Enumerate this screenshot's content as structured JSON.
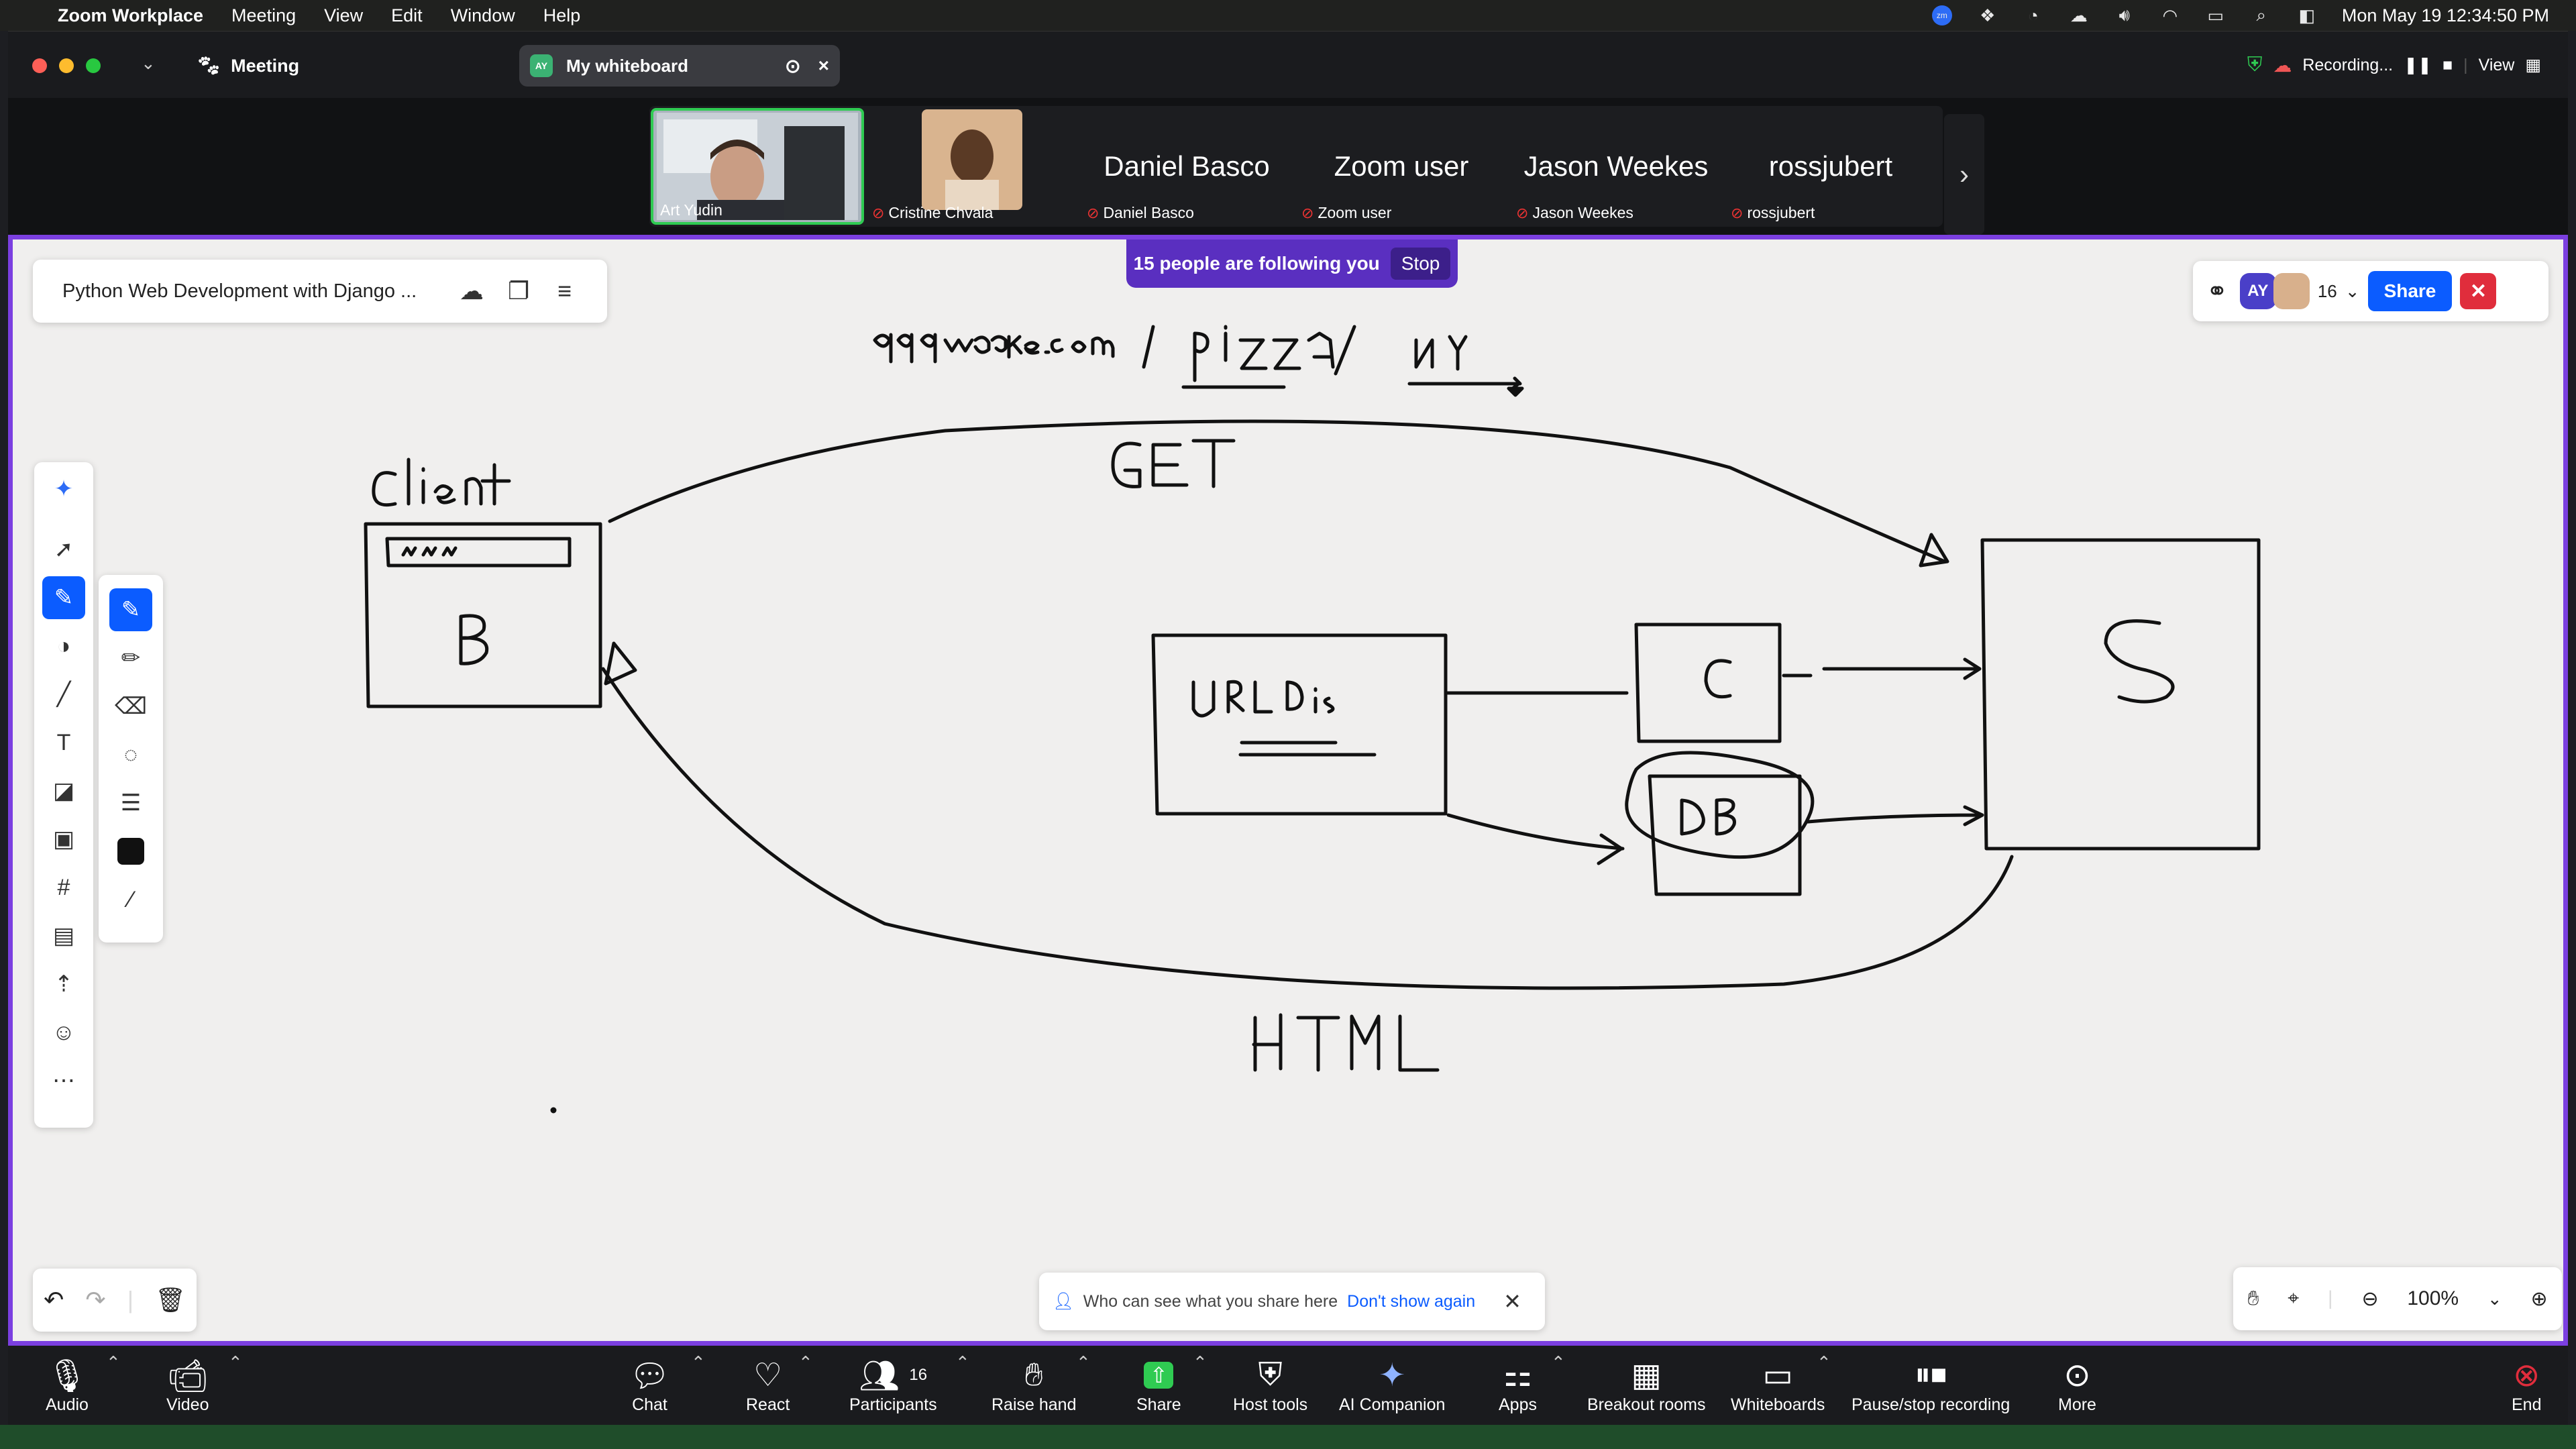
{
  "menubar": {
    "app": "Zoom Workplace",
    "items": [
      "Meeting",
      "View",
      "Edit",
      "Window",
      "Help"
    ],
    "datetime": "Mon May 19  12:34:50 PM"
  },
  "window": {
    "meeting_tab": "Meeting",
    "whiteboard_tab": "My whiteboard",
    "whiteboard_avatar": "AY",
    "recording": "Recording...",
    "view": "View"
  },
  "participants": [
    {
      "name": "Art Yudin",
      "type": "video"
    },
    {
      "name": "Cristine Chvala",
      "type": "photo"
    },
    {
      "name": "Daniel Basco",
      "type": "name"
    },
    {
      "name": "Zoom user",
      "type": "name"
    },
    {
      "name": "Jason Weekes",
      "type": "name"
    },
    {
      "name": "rossjubert",
      "type": "name"
    }
  ],
  "whiteboard": {
    "title": "Python Web Development with Django ...",
    "follow_text": "15 people are following you",
    "stop_label": "Stop",
    "avatar_initials": "AY",
    "participant_count": "16",
    "share_label": "Share",
    "notice_text": "Who can see what you share here",
    "notice_link": "Don't show again",
    "zoom_level": "100%",
    "handwriting": {
      "url": "appmake.com / pizza / NY",
      "method": "GET",
      "client": "Client",
      "browser": "B",
      "browser_bar": "www",
      "urldis": "URLDis",
      "c": "C",
      "db": "DB",
      "server": "S",
      "response": "HTML"
    }
  },
  "bottombar": {
    "audio": "Audio",
    "video": "Video",
    "chat": "Chat",
    "react": "React",
    "participants": "Participants",
    "participants_count": "16",
    "raise_hand": "Raise hand",
    "share": "Share",
    "host_tools": "Host tools",
    "ai_companion": "AI Companion",
    "apps": "Apps",
    "breakout": "Breakout rooms",
    "whiteboards": "Whiteboards",
    "recording": "Pause/stop recording",
    "more": "More",
    "end": "End"
  },
  "colors": {
    "accent": "#0b5cff",
    "border": "#7b3fe0",
    "end": "#e02d3c"
  }
}
